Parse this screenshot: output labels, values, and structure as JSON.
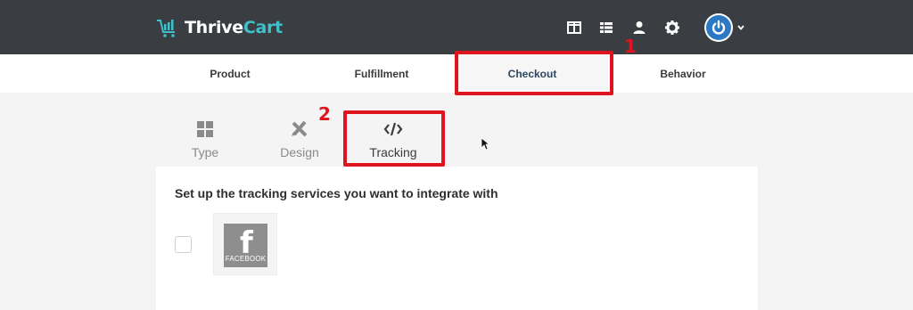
{
  "app": {
    "brand_part1": "Thrive",
    "brand_part2": "Cart",
    "brand_color": "#3fc1c9"
  },
  "topbar": {
    "icons": [
      "layout-icon",
      "list-icon",
      "user-icon",
      "gear-icon"
    ],
    "avatar_icon": "power-icon"
  },
  "tabs": [
    {
      "label": "Product"
    },
    {
      "label": "Fulfillment"
    },
    {
      "label": "Checkout",
      "active": true
    },
    {
      "label": "Behavior"
    }
  ],
  "annotations": {
    "one": "1",
    "two": "2",
    "color": "#e0141e"
  },
  "subtabs": [
    {
      "label": "Type",
      "icon": "grid-icon"
    },
    {
      "label": "Design",
      "icon": "design-tools-icon"
    },
    {
      "label": "Tracking",
      "icon": "code-icon",
      "active": true
    }
  ],
  "panel": {
    "title": "Set up the tracking services you want to integrate with",
    "service": {
      "label": "FACEBOOK",
      "letter": "f",
      "checked": false
    }
  }
}
